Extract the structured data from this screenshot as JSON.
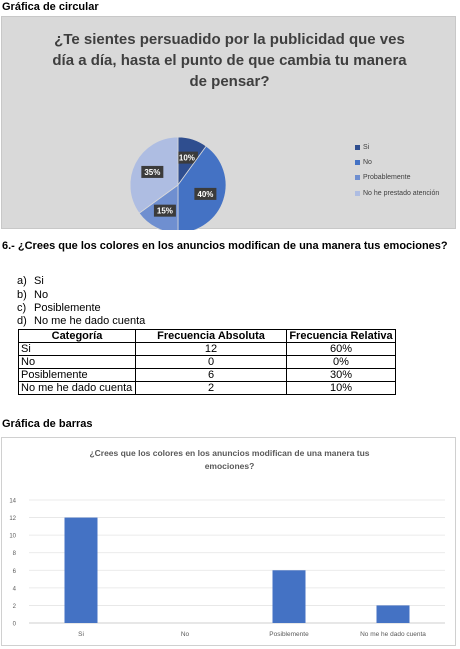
{
  "pie_section": {
    "heading": "Gráfica de circular"
  },
  "question": {
    "text": "6.- ¿Crees que los colores en los anuncios modifican de una manera tus emociones?",
    "options": [
      {
        "letter": "a)",
        "text": "Si"
      },
      {
        "letter": "b)",
        "text": "No"
      },
      {
        "letter": "c)",
        "text": "Posiblemente"
      },
      {
        "letter": "d)",
        "text": "No me he dado cuenta"
      }
    ]
  },
  "table": {
    "headers": [
      "Categoría",
      "Frecuencia Absoluta",
      "Frecuencia Relativa"
    ],
    "rows": [
      [
        "Si",
        "12",
        "60%"
      ],
      [
        "No",
        "0",
        "0%"
      ],
      [
        "Posiblemente",
        "6",
        "30%"
      ],
      [
        "No me he dado cuenta",
        "2",
        "10%"
      ]
    ]
  },
  "bar_section": {
    "heading": "Gráfica de barras"
  },
  "chart_data": [
    {
      "type": "pie",
      "title_lines": [
        "¿Te sientes persuadido por la publicidad que ves",
        "día a día, hasta el punto de que cambia tu manera",
        "de pensar?"
      ],
      "categories": [
        "Si",
        "No",
        "Probablemente",
        "No he prestado atención"
      ],
      "values": [
        10,
        40,
        15,
        35
      ],
      "labels": [
        "10%",
        "40%",
        "15%",
        "35%"
      ],
      "colors": [
        "#2f4e8f",
        "#4472c4",
        "#6f8fd0",
        "#aebde2"
      ],
      "legend": "right"
    },
    {
      "type": "bar",
      "title_lines": [
        "¿Crees que los colores en los anuncios modifican de una manera tus",
        "emociones?"
      ],
      "categories": [
        "Si",
        "No",
        "Posiblemente",
        "No me he dado cuenta"
      ],
      "values": [
        12,
        0,
        6,
        2
      ],
      "ylim": [
        0,
        14
      ],
      "yticks": [
        0,
        2,
        4,
        6,
        8,
        10,
        12,
        14
      ],
      "grid": true,
      "color": "#4472c4"
    }
  ]
}
